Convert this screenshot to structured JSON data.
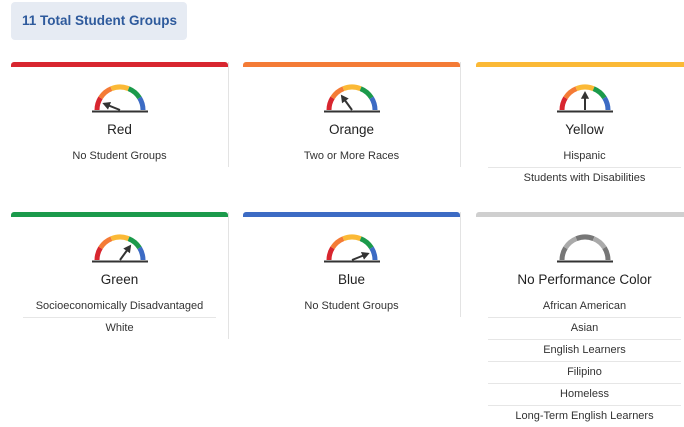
{
  "header": {
    "total_label": "11 Total Student Groups"
  },
  "colors": {
    "red": "#d8262f",
    "orange": "#f47b36",
    "yellow": "#fbb936",
    "green": "#1b9a4b",
    "blue": "#3c6bc4",
    "gray": "#cfcfcf",
    "gauge_gray_dark": "#777777",
    "gauge_gray_light": "#aaaaaa"
  },
  "cards": [
    {
      "key": "red",
      "label": "Red",
      "needle_level": 0.12,
      "groups": [
        "No Student Groups"
      ]
    },
    {
      "key": "orange",
      "label": "Orange",
      "needle_level": 0.3,
      "groups": [
        "Two or More Races"
      ]
    },
    {
      "key": "yellow",
      "label": "Yellow",
      "needle_level": 0.5,
      "groups": [
        "Hispanic",
        "Students with Disabilities"
      ]
    },
    {
      "key": "green",
      "label": "Green",
      "needle_level": 0.7,
      "groups": [
        "Socioeconomically Disadvantaged",
        "White"
      ]
    },
    {
      "key": "blue",
      "label": "Blue",
      "needle_level": 0.88,
      "groups": [
        "No Student Groups"
      ]
    },
    {
      "key": "none",
      "label": "No Performance Color",
      "needle_level": null,
      "groups": [
        "African American",
        "Asian",
        "English Learners",
        "Filipino",
        "Homeless",
        "Long-Term English Learners"
      ]
    }
  ]
}
